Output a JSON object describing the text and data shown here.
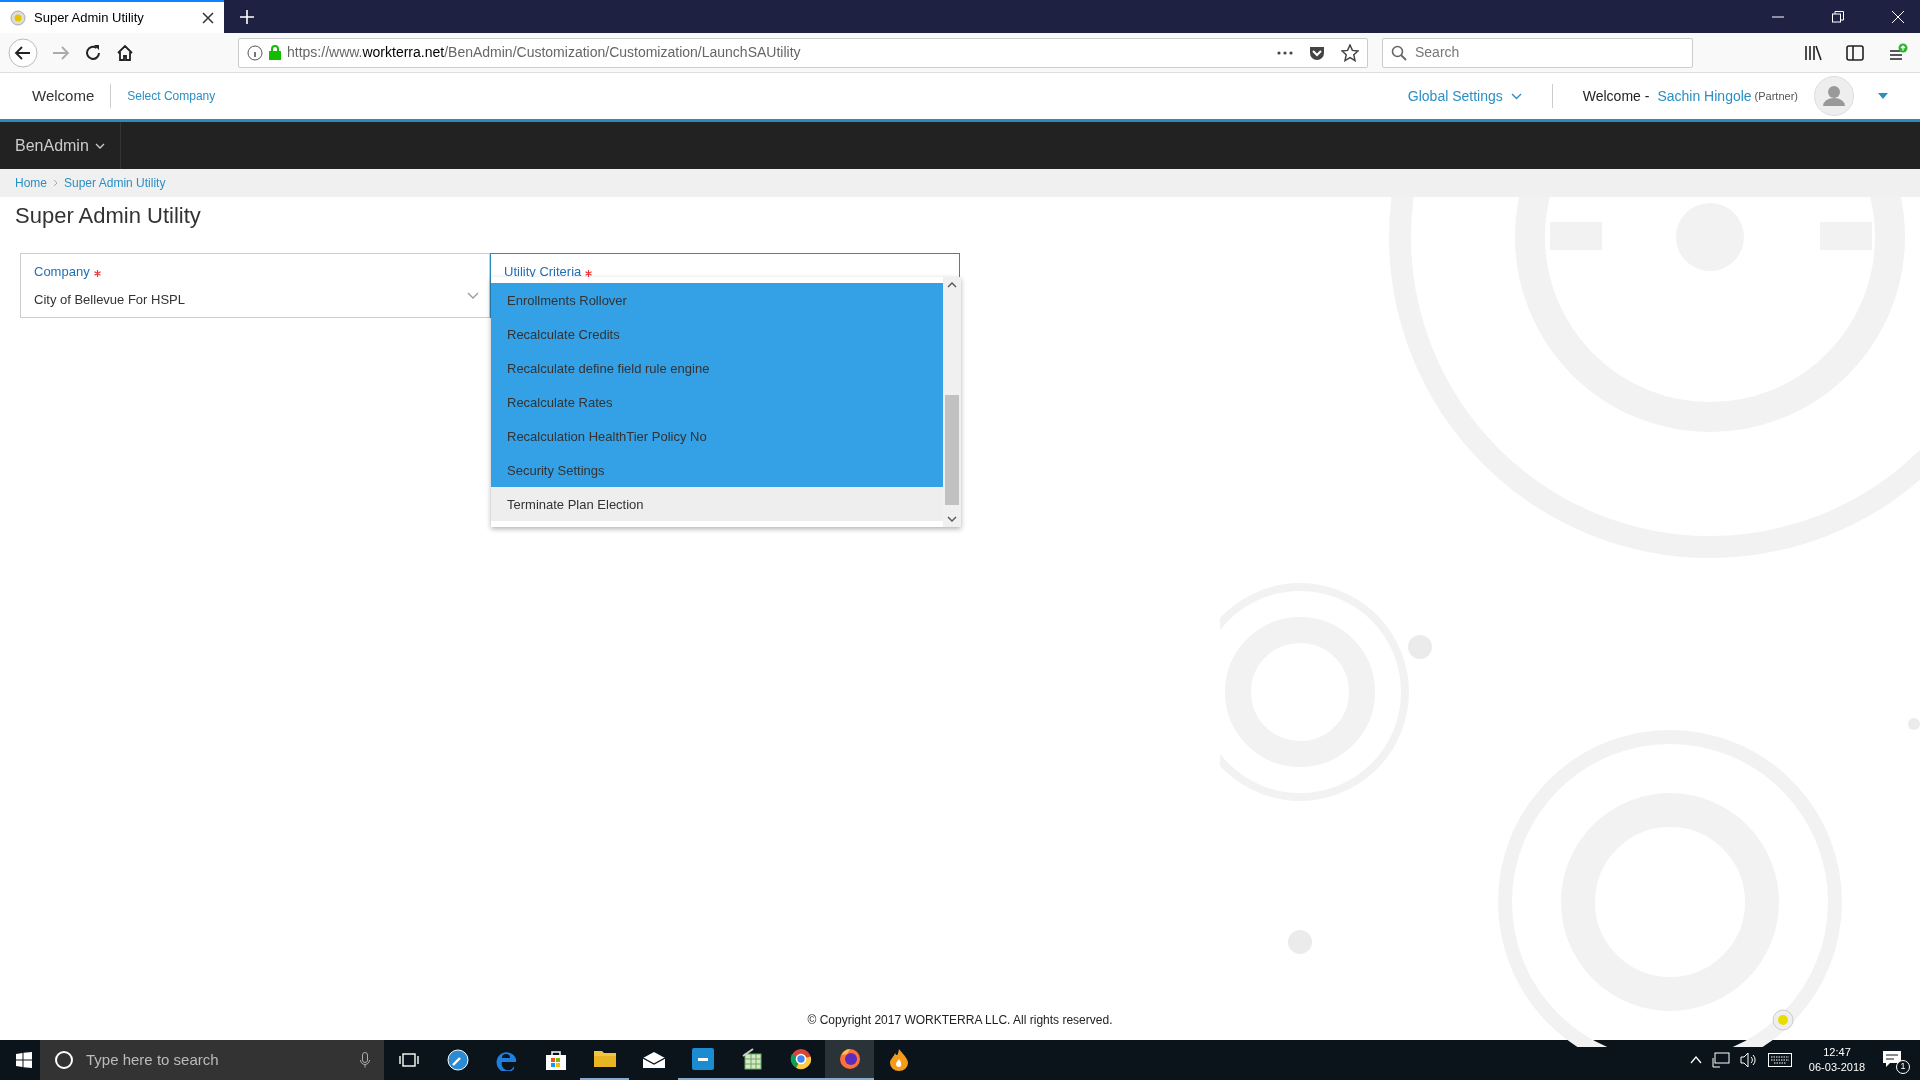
{
  "browser": {
    "tab_title": "Super Admin Utility",
    "url": {
      "prefix": "https://www.",
      "domain": "workterra.net",
      "path": "/BenAdmin/Customization/Customization/LaunchSAUtility"
    },
    "search_placeholder": "Search"
  },
  "header": {
    "welcome": "Welcome",
    "select_company": "Select Company",
    "global_settings": "Global Settings",
    "greeting": "Welcome -",
    "user_name": "Sachin Hingole",
    "user_role": "(Partner)"
  },
  "nav": [
    {
      "label": "BenAdmin"
    }
  ],
  "breadcrumb": [
    {
      "label": "Home"
    },
    {
      "label": "Super Admin Utility"
    }
  ],
  "page_title": "Super Admin Utility",
  "company": {
    "label": "Company",
    "required": true,
    "value": "City of Bellevue For HSPL"
  },
  "utility_criteria": {
    "label": "Utility Criteria",
    "required": true,
    "options": [
      {
        "label": "Enrollments Rollover",
        "selected": true,
        "hovered": false
      },
      {
        "label": "Recalculate Credits",
        "selected": true,
        "hovered": false
      },
      {
        "label": "Recalculate define field rule engine",
        "selected": true,
        "hovered": false
      },
      {
        "label": "Recalculate Rates",
        "selected": true,
        "hovered": false
      },
      {
        "label": "Recalculation HealthTier Policy No",
        "selected": true,
        "hovered": false
      },
      {
        "label": "Security Settings",
        "selected": true,
        "hovered": false
      },
      {
        "label": "Terminate Plan Election",
        "selected": false,
        "hovered": true
      }
    ]
  },
  "footer": {
    "copyright": "© Copyright 2017 WORKTERRA LLC. All rights reserved."
  },
  "taskbar": {
    "search_placeholder": "Type here to search",
    "time": "12:47",
    "date": "06-03-2018",
    "notifications": "1"
  }
}
